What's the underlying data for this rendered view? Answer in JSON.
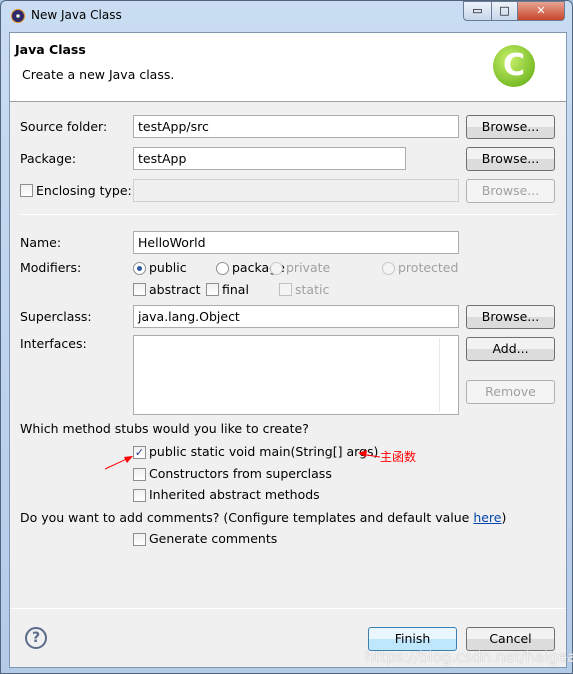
{
  "window": {
    "title": "New Java Class",
    "minimize": "▭",
    "maximize": "□",
    "close": "✕"
  },
  "header": {
    "title": "Java Class",
    "description": "Create a new Java class.",
    "logo_letter": "C"
  },
  "form": {
    "source_folder": {
      "label": "Source folder:",
      "value": "testApp/src",
      "browse": "Browse..."
    },
    "package": {
      "label": "Package:",
      "value": "testApp",
      "browse": "Browse..."
    },
    "enclosing": {
      "label": "Enclosing type:",
      "value": "",
      "browse": "Browse...",
      "checked": false
    },
    "name": {
      "label": "Name:",
      "value": "HelloWorld"
    },
    "modifiers": {
      "label": "Modifiers:",
      "public": "public",
      "package": "package",
      "private": "private",
      "protected": "protected",
      "abstract": "abstract",
      "final": "final",
      "static": "static",
      "selected": "public"
    },
    "superclass": {
      "label": "Superclass:",
      "value": "java.lang.Object",
      "browse": "Browse..."
    },
    "interfaces": {
      "label": "Interfaces:",
      "add": "Add...",
      "remove": "Remove"
    },
    "stubs": {
      "question": "Which method stubs would you like to create?",
      "main": "public static void main(String[] args)",
      "main_checked": true,
      "constructors": "Constructors from superclass",
      "inherited": "Inherited abstract methods"
    },
    "comments": {
      "question": "Do you want to add comments? (Configure templates and default value ",
      "link": "here",
      "close_paren": ")",
      "generate": "Generate comments"
    }
  },
  "annotation": {
    "text": "主函数",
    "color": "#ff0000"
  },
  "footer": {
    "finish": "Finish",
    "cancel": "Cancel",
    "help": "?"
  },
  "watermark": "https://blog.csdn.net/haigear"
}
